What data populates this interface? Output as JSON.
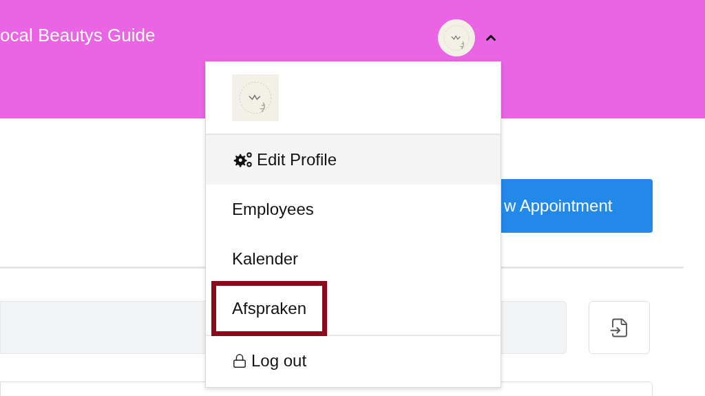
{
  "header": {
    "title": "ocal Beautys Guide",
    "menu_open": true
  },
  "new_appointment_button": {
    "label": "w Appointment"
  },
  "search_field": {
    "kind": "field"
  },
  "profile_menu": {
    "items": [
      {
        "label": "Edit Profile",
        "kind": "settings",
        "selected": true,
        "highlighted": false
      },
      {
        "label": "Employees",
        "kind": "plain",
        "selected": false,
        "highlighted": false
      },
      {
        "label": "Kalender",
        "kind": "plain",
        "selected": false,
        "highlighted": false
      },
      {
        "label": "Afspraken",
        "kind": "plain",
        "selected": false,
        "highlighted": true
      },
      {
        "label": "Log out",
        "kind": "logout",
        "selected": false,
        "highlighted": false
      }
    ]
  }
}
